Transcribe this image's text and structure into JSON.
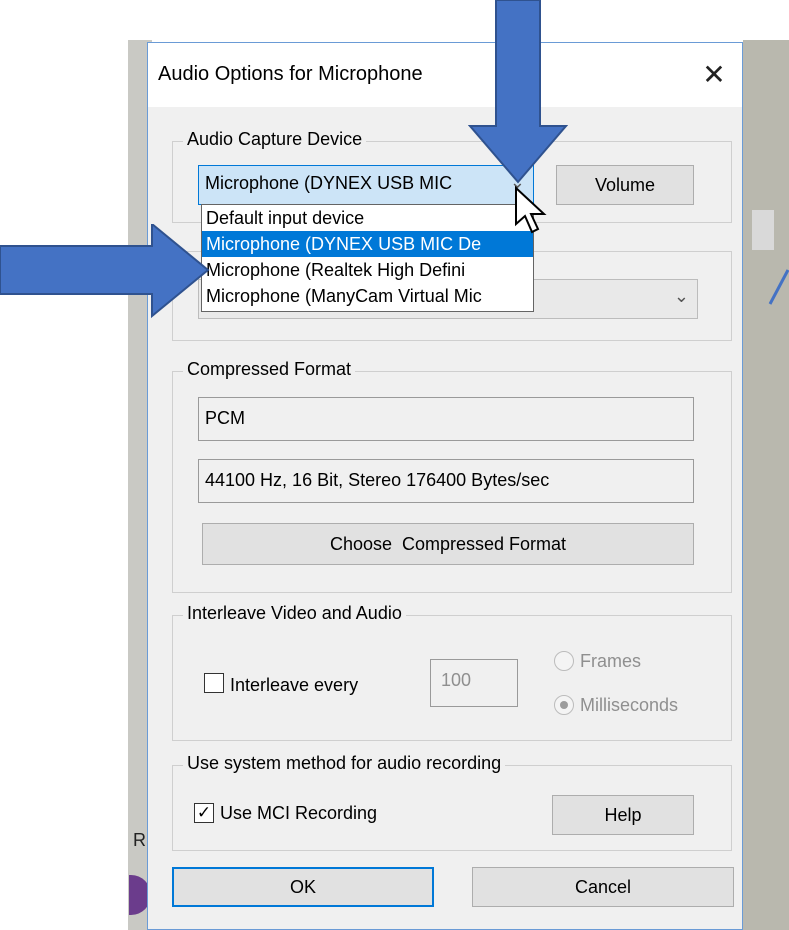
{
  "dialog": {
    "title": "Audio Options for Microphone",
    "close_glyph": "✕"
  },
  "capture": {
    "group_label": "Audio Capture Device",
    "selected_device": "Microphone (DYNEX USB MIC",
    "volume_label": "Volume",
    "options": [
      "Default input device",
      "Microphone (DYNEX USB MIC De",
      "Microphone (Realtek High Defini",
      "Microphone (ManyCam Virtual Mic"
    ],
    "selected_index": 1
  },
  "compressed": {
    "group_label": "Compressed Format",
    "format": "PCM",
    "details": "44100 Hz, 16 Bit, Stereo 176400 Bytes/sec",
    "choose_label": "Choose  Compressed Format"
  },
  "interleave": {
    "group_label": "Interleave Video and Audio",
    "checkbox_label": "Interleave every",
    "checked": false,
    "value": "100",
    "frames_label": "Frames",
    "ms_label": "Milliseconds",
    "selected_unit": "Milliseconds"
  },
  "system": {
    "group_label": "Use system method for audio recording",
    "mci_label": "Use MCI Recording",
    "mci_checked": true,
    "help_label": "Help"
  },
  "footer": {
    "ok_label": "OK",
    "cancel_label": "Cancel"
  },
  "background": {
    "left_letter": "R"
  },
  "colors": {
    "arrow_fill": "#4472c4",
    "arrow_stroke": "#2f528f",
    "selection": "#0078d7"
  }
}
